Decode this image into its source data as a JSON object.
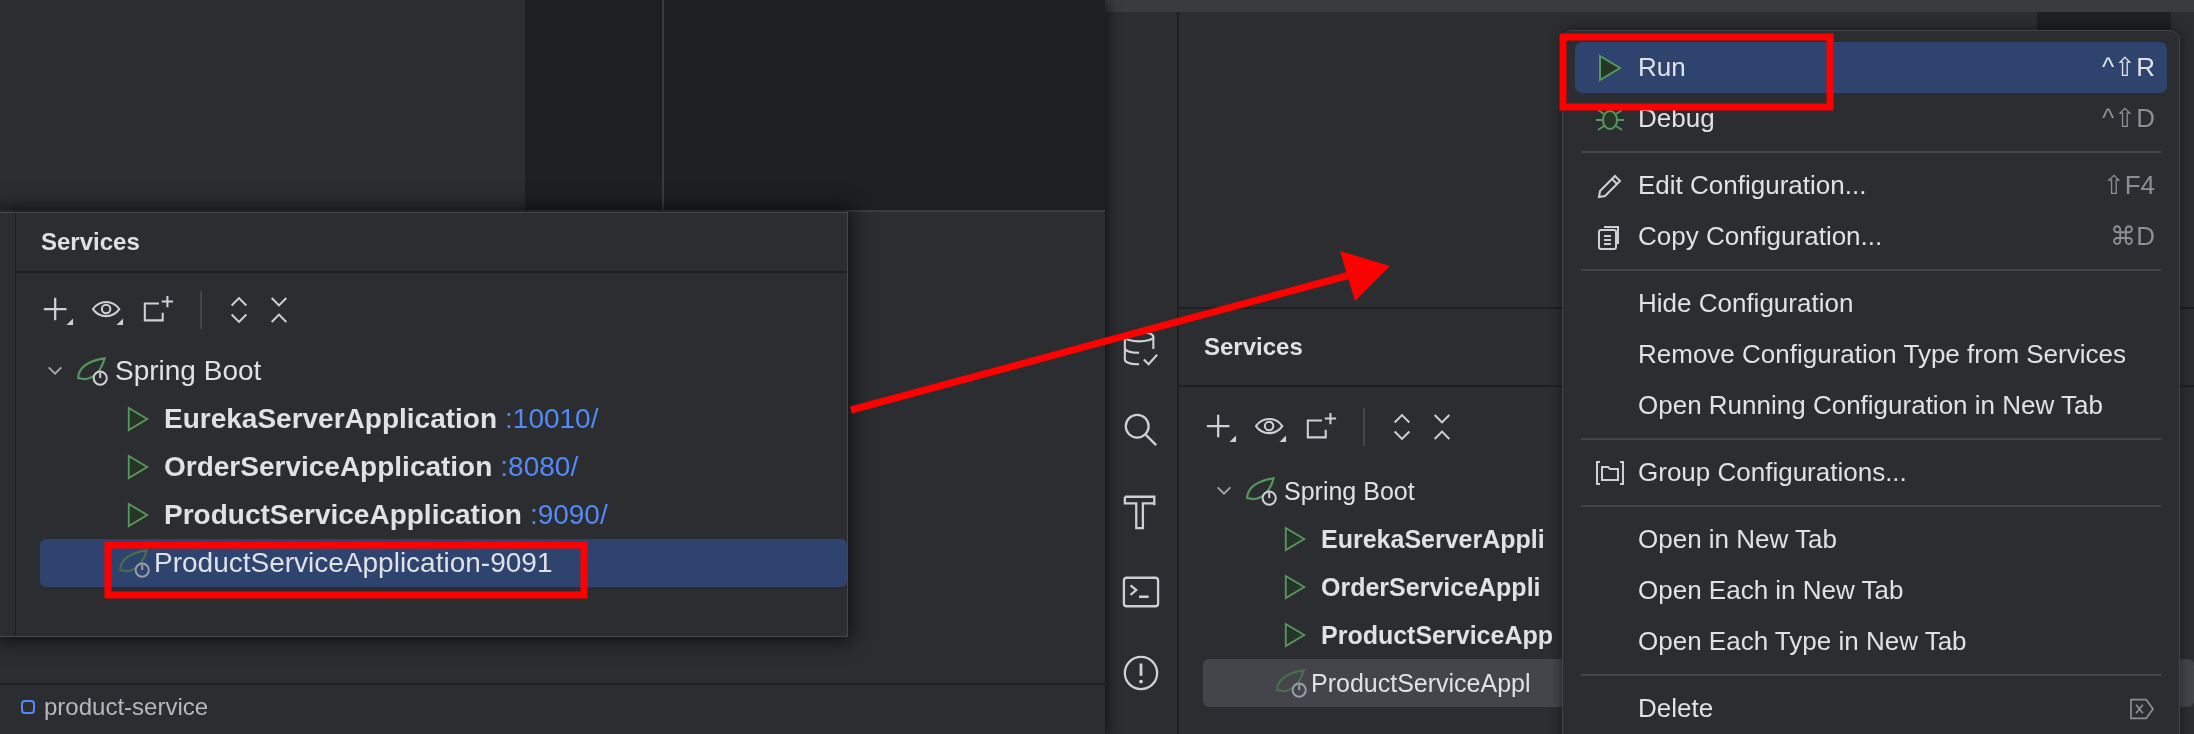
{
  "left_window": {
    "title": "Services",
    "focused": true,
    "tree": [
      {
        "label": "Spring Boot",
        "expanded": true,
        "children": [
          {
            "kind": "app",
            "name": "EurekaServerApplication",
            "port": ":10010/",
            "selected": false
          },
          {
            "kind": "app",
            "name": "OrderServiceApplication",
            "port": ":8080/",
            "selected": false
          },
          {
            "kind": "app",
            "name": "ProductServiceApplication",
            "port": ":9090/",
            "selected": false
          },
          {
            "kind": "config",
            "name": "ProductServiceApplication-9091",
            "selected": true
          }
        ]
      }
    ],
    "status_bar": {
      "module": "product-service"
    }
  },
  "right_window": {
    "title": "Services",
    "focused": false,
    "tree": [
      {
        "label": "Spring Boot",
        "expanded": true,
        "children": [
          {
            "kind": "app",
            "name": "EurekaServerAppli",
            "selected": false
          },
          {
            "kind": "app",
            "name": "OrderServiceAppli",
            "selected": false
          },
          {
            "kind": "app",
            "name": "ProductServiceApp",
            "selected": false
          },
          {
            "kind": "config",
            "name": "ProductServiceAppl",
            "selected": true
          }
        ]
      }
    ]
  },
  "context_menu": [
    {
      "kind": "run",
      "label": "Run",
      "shortcut": "^⇧R",
      "selected": true
    },
    {
      "kind": "debug",
      "label": "Debug",
      "shortcut": "^⇧D",
      "selected": false
    },
    {
      "kind": "separator"
    },
    {
      "kind": "edit",
      "label": "Edit Configuration...",
      "shortcut": "⇧F4",
      "selected": false
    },
    {
      "kind": "copy",
      "label": "Copy Configuration...",
      "shortcut": "⌘D",
      "selected": false
    },
    {
      "kind": "separator"
    },
    {
      "kind": "plain",
      "label": "Hide Configuration",
      "selected": false
    },
    {
      "kind": "plain",
      "label": "Remove Configuration Type from Services",
      "selected": false
    },
    {
      "kind": "plain",
      "label": "Open Running Configuration in New Tab",
      "selected": false
    },
    {
      "kind": "separator"
    },
    {
      "kind": "group",
      "label": "Group Configurations...",
      "selected": false
    },
    {
      "kind": "separator"
    },
    {
      "kind": "plain",
      "label": "Open in New Tab",
      "selected": false
    },
    {
      "kind": "plain",
      "label": "Open Each in New Tab",
      "selected": false
    },
    {
      "kind": "plain",
      "label": "Open Each Type in New Tab",
      "selected": false
    },
    {
      "kind": "separator"
    },
    {
      "kind": "delete",
      "label": "Delete",
      "selected": false
    }
  ]
}
